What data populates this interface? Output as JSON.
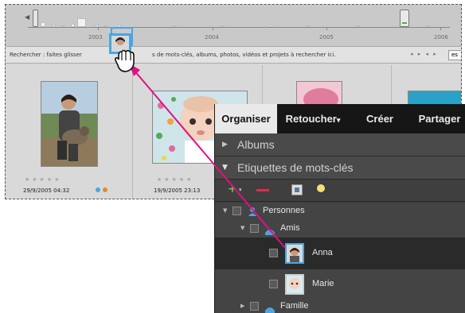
{
  "timeline": {
    "years": [
      "2003",
      "2004",
      "2005",
      "2006"
    ]
  },
  "search": {
    "text_left": "Rechercher : faites glisser",
    "text_right": "s de mots-clés, albums, photos, vidéos et projets à rechercher ici.",
    "field_label": "es"
  },
  "photos": [
    {
      "date": "29/9/2005 04:32",
      "stars": "★★★★★"
    },
    {
      "date": "19/9/2005 23:13",
      "stars": "★★★★★"
    }
  ],
  "panel": {
    "tabs": [
      {
        "label": "Organiser"
      },
      {
        "label": "Retoucher"
      },
      {
        "label": "Créer"
      },
      {
        "label": "Partager"
      }
    ],
    "albums_label": "Albums",
    "keywords_label": "Etiquettes de mots-clés",
    "keywords": {
      "personnes": "Personnes",
      "amis": "Amis",
      "anna": "Anna",
      "marie": "Marie",
      "famille": "Famille"
    }
  },
  "colors": {
    "tab_active_bg": "#e9e9e9",
    "panel_bg": "#3b3b3b",
    "selected_row": "#2a2a2a",
    "drag_arrow": "#e0117f",
    "tag_blue": "#4aa6e0",
    "tag_orange": "#e08a2a"
  }
}
